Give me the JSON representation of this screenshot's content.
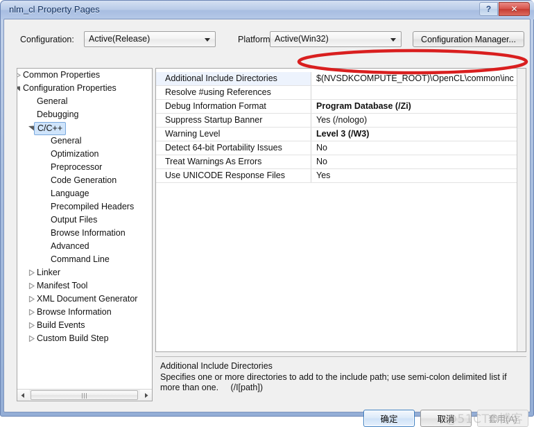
{
  "window": {
    "title": "nlm_cl Property Pages",
    "help_button": "?",
    "close_button": "✕"
  },
  "config_bar": {
    "configuration_label": "Configuration:",
    "configuration_value": "Active(Release)",
    "platform_label": "Platform:",
    "platform_value": "Active(Win32)",
    "configuration_manager_button": "Configuration Manager..."
  },
  "tree": {
    "items": [
      {
        "label": "Common Properties",
        "indent": 0,
        "state": "collapsed",
        "selected": false
      },
      {
        "label": "Configuration Properties",
        "indent": 0,
        "state": "expanded",
        "selected": false
      },
      {
        "label": "General",
        "indent": 1,
        "state": "leaf",
        "selected": false
      },
      {
        "label": "Debugging",
        "indent": 1,
        "state": "leaf",
        "selected": false
      },
      {
        "label": "C/C++",
        "indent": 1,
        "state": "expanded",
        "selected": true
      },
      {
        "label": "General",
        "indent": 2,
        "state": "leaf",
        "selected": false
      },
      {
        "label": "Optimization",
        "indent": 2,
        "state": "leaf",
        "selected": false
      },
      {
        "label": "Preprocessor",
        "indent": 2,
        "state": "leaf",
        "selected": false
      },
      {
        "label": "Code Generation",
        "indent": 2,
        "state": "leaf",
        "selected": false
      },
      {
        "label": "Language",
        "indent": 2,
        "state": "leaf",
        "selected": false
      },
      {
        "label": "Precompiled Headers",
        "indent": 2,
        "state": "leaf",
        "selected": false
      },
      {
        "label": "Output Files",
        "indent": 2,
        "state": "leaf",
        "selected": false
      },
      {
        "label": "Browse Information",
        "indent": 2,
        "state": "leaf",
        "selected": false
      },
      {
        "label": "Advanced",
        "indent": 2,
        "state": "leaf",
        "selected": false
      },
      {
        "label": "Command Line",
        "indent": 2,
        "state": "leaf",
        "selected": false
      },
      {
        "label": "Linker",
        "indent": 1,
        "state": "collapsed",
        "selected": false
      },
      {
        "label": "Manifest Tool",
        "indent": 1,
        "state": "collapsed",
        "selected": false
      },
      {
        "label": "XML Document Generator",
        "indent": 1,
        "state": "collapsed",
        "selected": false
      },
      {
        "label": "Browse Information",
        "indent": 1,
        "state": "collapsed",
        "selected": false
      },
      {
        "label": "Build Events",
        "indent": 1,
        "state": "collapsed",
        "selected": false
      },
      {
        "label": "Custom Build Step",
        "indent": 1,
        "state": "collapsed",
        "selected": false
      }
    ],
    "hscrollbar": {
      "left_arrow": "◄",
      "right_arrow": "►"
    }
  },
  "grid": {
    "rows": [
      {
        "name": "Additional Include Directories",
        "value": "$(NVSDKCOMPUTE_ROOT)\\OpenCL\\common\\inc",
        "bold": false,
        "selected": true
      },
      {
        "name": "Resolve #using References",
        "value": "",
        "bold": false,
        "selected": false
      },
      {
        "name": "Debug Information Format",
        "value": "Program Database (/Zi)",
        "bold": true,
        "selected": false
      },
      {
        "name": "Suppress Startup Banner",
        "value": "Yes (/nologo)",
        "bold": false,
        "selected": false
      },
      {
        "name": "Warning Level",
        "value": "Level 3 (/W3)",
        "bold": true,
        "selected": false
      },
      {
        "name": "Detect 64-bit Portability Issues",
        "value": "No",
        "bold": false,
        "selected": false
      },
      {
        "name": "Treat Warnings As Errors",
        "value": "No",
        "bold": false,
        "selected": false
      },
      {
        "name": "Use UNICODE Response Files",
        "value": "Yes",
        "bold": false,
        "selected": false
      }
    ]
  },
  "description": {
    "title": "Additional Include Directories",
    "body": "Specifies one or more directories to add to the include path; use semi-colon delimited list if more than one.     (/I[path])"
  },
  "buttons": {
    "ok": "确定",
    "cancel": "取消",
    "apply": "套用(A)"
  },
  "annotation": {
    "shape": "red-ellipse",
    "color": "#d91f1f",
    "targets": "Additional Include Directories value"
  },
  "watermark": "@51CTO博客"
}
